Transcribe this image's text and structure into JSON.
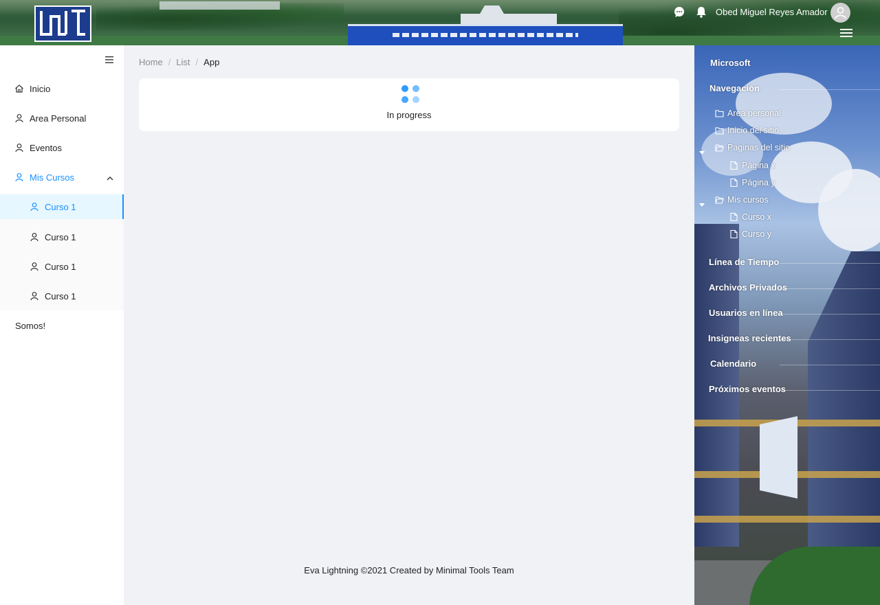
{
  "header": {
    "user_name": "Obed Miguel Reyes Amador",
    "icons": [
      "logo",
      "chat-icon",
      "bell-icon",
      "avatar-icon",
      "hamburger-icon"
    ]
  },
  "sidebar": {
    "items": [
      {
        "label": "Inicio",
        "icon": "home-icon"
      },
      {
        "label": "Area Personal",
        "icon": "user-icon"
      },
      {
        "label": "Eventos",
        "icon": "user-icon"
      },
      {
        "label": "Mis Cursos",
        "icon": "user-icon",
        "expanded": true
      }
    ],
    "sub_items": [
      {
        "label": "Curso 1",
        "active": true
      },
      {
        "label": "Curso 1",
        "active": false
      },
      {
        "label": "Curso 1",
        "active": false
      },
      {
        "label": "Curso 1",
        "active": false
      }
    ],
    "footer_link": "Somos!",
    "accent_color": "#1890ff"
  },
  "breadcrumb": [
    "Home",
    "List",
    "App"
  ],
  "main": {
    "status_text": "In progress"
  },
  "footer": {
    "text": "Eva Lightning ©2021 Created by Minimal Tools Team"
  },
  "right_panel": {
    "headings": [
      "Microsoft",
      "Navegación",
      "Línea de Tiempo",
      "Archivos Privados",
      "Usuarios en línea",
      "Insigneas recientes",
      "Calendario",
      "Próximos eventos"
    ],
    "nav_tree": {
      "area_personal": "Area personal",
      "inicio_sitio": "Inicio del sitio",
      "paginas_sitio": "Paginas del sitio",
      "pagina_x": "Página x",
      "pagina_y": "Página y",
      "mis_cursos": "Mis cursos",
      "curso_x": "Curso x",
      "curso_y": "Curso y"
    }
  }
}
